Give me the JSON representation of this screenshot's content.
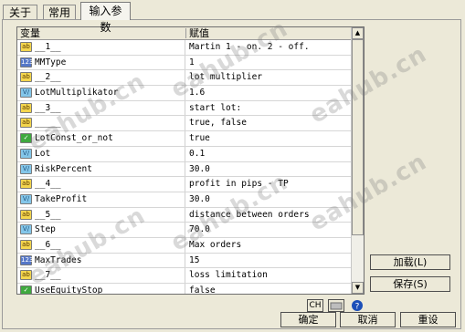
{
  "tabs": [
    {
      "label": "关于"
    },
    {
      "label": "常用"
    },
    {
      "label": "输入参数"
    }
  ],
  "grid": {
    "header": {
      "variable": "变量",
      "value": "赋值"
    },
    "rows": [
      {
        "icon": "ab",
        "name": "__1__",
        "value": "Martin 1 - on. 2 - off."
      },
      {
        "icon": "num",
        "name": "MMType",
        "value": "1"
      },
      {
        "icon": "ab",
        "name": "__2__",
        "value": "lot multiplier"
      },
      {
        "icon": "v",
        "name": "LotMultiplikator",
        "value": "1.6"
      },
      {
        "icon": "ab",
        "name": "__3__",
        "value": "start lot:"
      },
      {
        "icon": "ab",
        "name": "_____",
        "value": "true, false"
      },
      {
        "icon": "bool",
        "name": "LotConst_or_not",
        "value": "true"
      },
      {
        "icon": "v",
        "name": "Lot",
        "value": "0.1"
      },
      {
        "icon": "v",
        "name": "RiskPercent",
        "value": "30.0"
      },
      {
        "icon": "ab",
        "name": "__4__",
        "value": "profit in pips - TP"
      },
      {
        "icon": "v",
        "name": "TakeProfit",
        "value": "30.0"
      },
      {
        "icon": "ab",
        "name": "__5__",
        "value": "distance between orders"
      },
      {
        "icon": "v",
        "name": "Step",
        "value": "70.0"
      },
      {
        "icon": "ab",
        "name": "__6__",
        "value": "Max orders"
      },
      {
        "icon": "num",
        "name": "MaxTrades",
        "value": "15"
      },
      {
        "icon": "ab",
        "name": "__7__",
        "value": "loss limitation"
      },
      {
        "icon": "bool",
        "name": "UseEquityStop",
        "value": "false"
      }
    ]
  },
  "buttons": {
    "load": "加载(L)",
    "save": "保存(S)",
    "ok": "确定",
    "cancel": "取消",
    "reset": "重设"
  },
  "status": {
    "lang": "CH"
  },
  "watermark": "eahub.cn"
}
